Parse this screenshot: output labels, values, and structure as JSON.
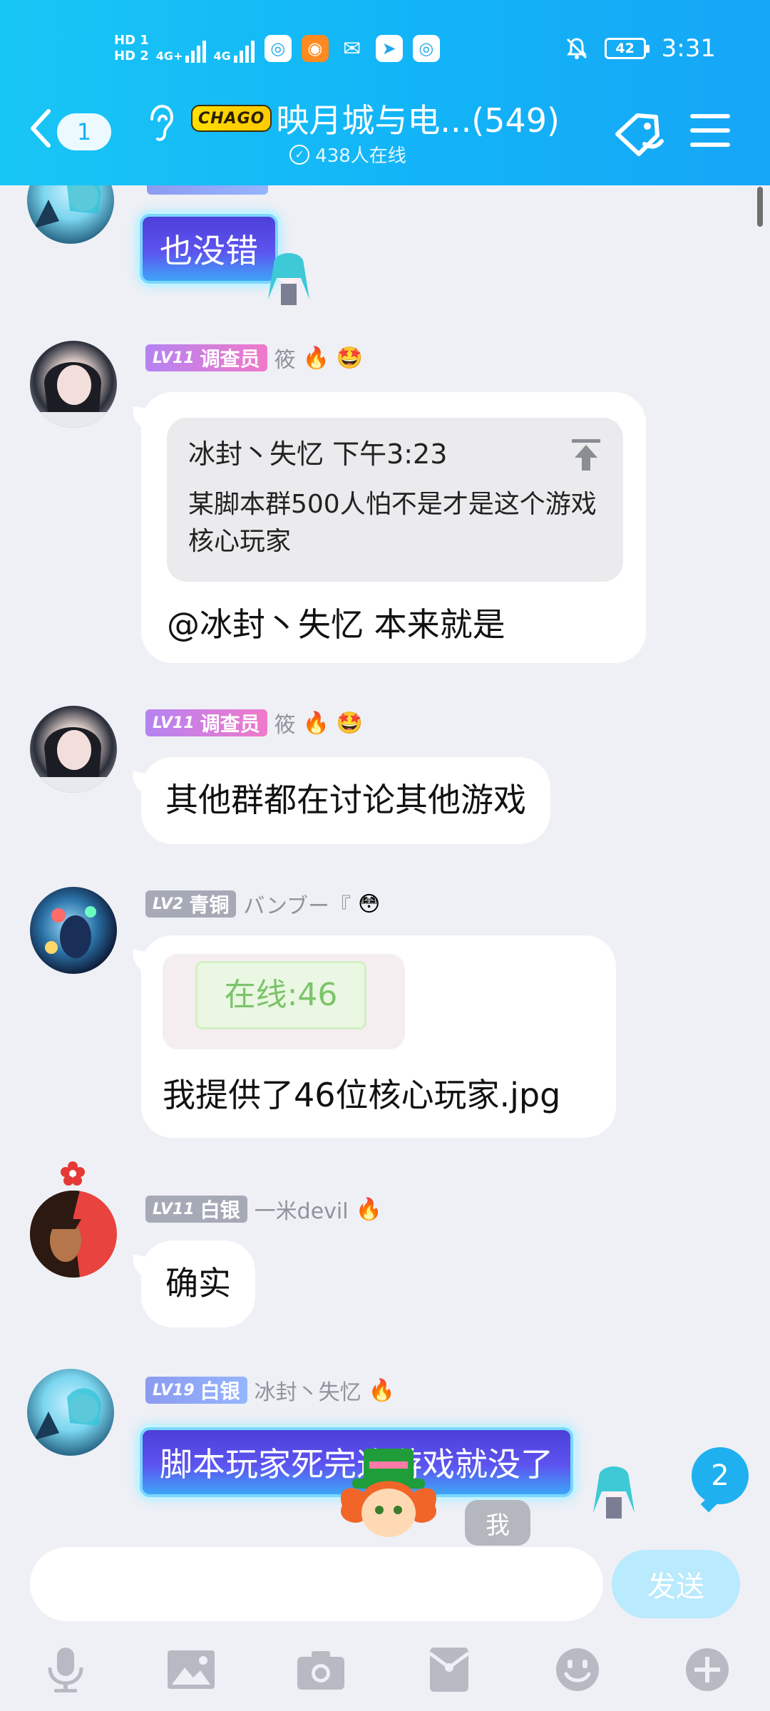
{
  "status_bar": {
    "hd1": "HD 1",
    "hd2": "HD 2",
    "net1": "4G+",
    "net2": "4G",
    "battery": "42",
    "time": "3:31"
  },
  "header": {
    "unread": "1",
    "group_badge": "CHAGO",
    "title": "映月城与电...(549)",
    "online": "438人在线"
  },
  "messages": [
    {
      "type": "fancy",
      "text": "也没错"
    },
    {
      "badge_level": "LV11",
      "badge_title": "调查员",
      "nickname": "筱",
      "emoji": "🔥 🤩",
      "quote_author_time": "冰封丶失忆 下午3:23",
      "quote_text": "某脚本群500人怕不是才是这个游戏核心玩家",
      "text": "@冰封丶失忆 本来就是"
    },
    {
      "badge_level": "LV11",
      "badge_title": "调查员",
      "nickname": "筱",
      "emoji": "🔥 🤩",
      "text": "其他群都在讨论其他游戏"
    },
    {
      "badge_level": "LV2",
      "badge_title": "青铜",
      "nickname": "バンブー『",
      "emoji": "😳",
      "image_text": "在线:46",
      "text": "我提供了46位核心玩家.jpg"
    },
    {
      "badge_level": "LV11",
      "badge_title": "白银",
      "nickname": "一米devil",
      "emoji": "🔥",
      "text": "确实"
    },
    {
      "badge_level": "LV19",
      "badge_title": "白银",
      "nickname": "冰封丶失忆",
      "emoji": "🔥",
      "text": "脚本玩家死完这游戏就没了"
    }
  ],
  "new_messages_count": "2",
  "me_label": "我",
  "input": {
    "placeholder": "",
    "send_label": "发送"
  },
  "colors": {
    "header": "#12b4f7",
    "send_disabled": "#b9eafd",
    "badge_count": "#1fb0f0"
  }
}
